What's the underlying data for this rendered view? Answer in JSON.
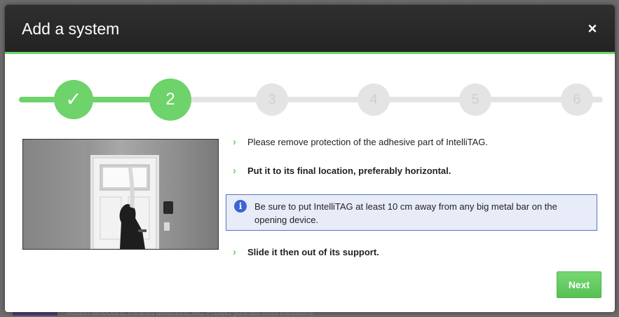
{
  "backdrop": {
    "text": "Motion detectors, infrared detectors, etc. Protect yourself from intrusions."
  },
  "modal": {
    "title": "Add a system",
    "close_label": "×"
  },
  "stepper": {
    "steps": [
      {
        "label": "✓",
        "state": "done"
      },
      {
        "label": "2",
        "state": "active"
      },
      {
        "label": "3",
        "state": "todo"
      },
      {
        "label": "4",
        "state": "todo"
      },
      {
        "label": "5",
        "state": "todo"
      },
      {
        "label": "6",
        "state": "todo"
      }
    ],
    "current_step": 2,
    "total_steps": 6
  },
  "instructions": {
    "items": [
      {
        "text": "Please remove protection of the adhesive part of IntelliTAG."
      },
      {
        "text": "Put it to its final location, preferably horizontal."
      },
      {
        "text": "Slide it then out of its support."
      }
    ],
    "info": {
      "icon": "info-icon",
      "text": "Be sure to put IntelliTAG at least 10 cm away from any big metal bar on the opening device."
    }
  },
  "buttons": {
    "next_label": "Next"
  },
  "colors": {
    "accent": "#6dd36a",
    "header": "#2a2a2a",
    "info_border": "#5773c3",
    "info_bg": "#e8ecf8"
  }
}
